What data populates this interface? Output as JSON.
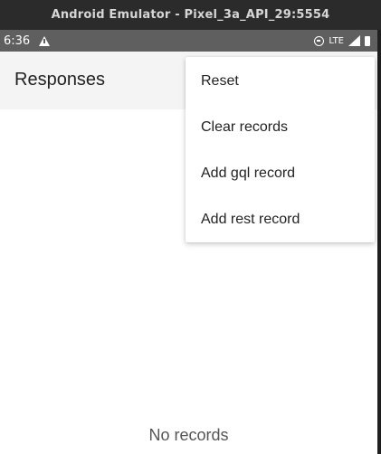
{
  "window": {
    "title": "Android Emulator - Pixel_3a_API_29:5554"
  },
  "status_bar": {
    "time": "6:36",
    "network_label": "LTE",
    "icons": [
      "warning-icon",
      "do-not-disturb-icon",
      "signal-icon",
      "battery-icon"
    ]
  },
  "app_bar": {
    "title": "Responses"
  },
  "overflow_menu": {
    "items": [
      {
        "label": "Reset"
      },
      {
        "label": "Clear records"
      },
      {
        "label": "Add gql record"
      },
      {
        "label": "Add rest record"
      }
    ]
  },
  "content": {
    "empty_state": "No records"
  },
  "colors": {
    "title_bar_bg": "#2b2b2b",
    "status_bar_bg": "#5f5f5f",
    "app_bar_bg": "#f4f4f4",
    "text_primary": "#222222",
    "text_secondary": "#555555"
  }
}
